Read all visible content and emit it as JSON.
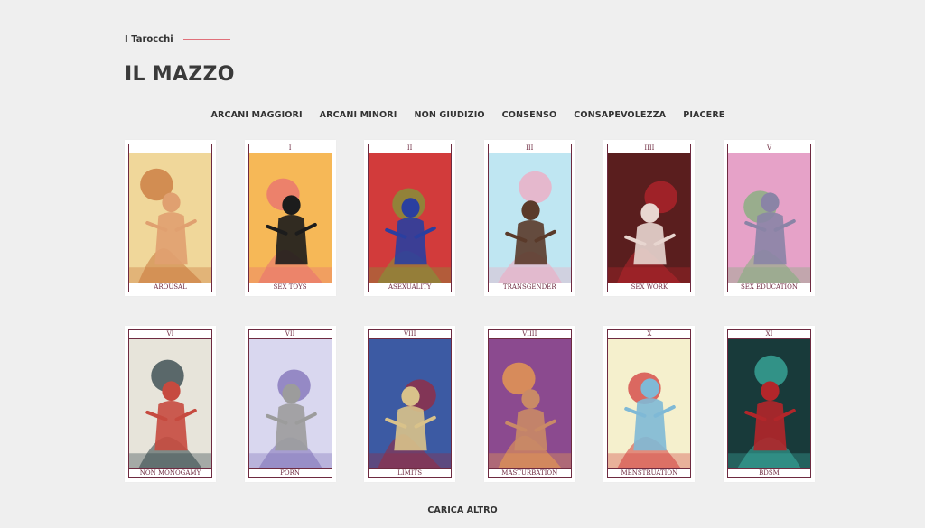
{
  "breadcrumb": {
    "label": "I Tarocchi"
  },
  "page_title": "IL MAZZO",
  "filters": [
    "ARCANI MAGGIORI",
    "ARCANI MINORI",
    "NON GIUDIZIO",
    "CONSENSO",
    "CONSAPEVOLEZZA",
    "PIACERE"
  ],
  "cards": [
    {
      "number": "",
      "name": "AROUSAL",
      "bg": "#f0d79a",
      "accent": "#c8743a",
      "figure": "#e0a070"
    },
    {
      "number": "I",
      "name": "SEX TOYS",
      "bg": "#f6b857",
      "accent": "#e86f72",
      "figure": "#1c1c1c"
    },
    {
      "number": "II",
      "name": "ASEXUALITY",
      "bg": "#d23b3b",
      "accent": "#7c9b3a",
      "figure": "#2a3fa0"
    },
    {
      "number": "III",
      "name": "TRANSGENDER",
      "bg": "#bfe6f2",
      "accent": "#f2a8c0",
      "figure": "#5a3a2a"
    },
    {
      "number": "IIII",
      "name": "SEX WORK",
      "bg": "#5a1e1e",
      "accent": "#b7242c",
      "figure": "#e8d6d0"
    },
    {
      "number": "V",
      "name": "SEX EDUCATION",
      "bg": "#e6a2c8",
      "accent": "#7fb07a",
      "figure": "#8a84a6"
    },
    {
      "number": "VI",
      "name": "NON MONOGAMY",
      "bg": "#e7e4da",
      "accent": "#2b3f44",
      "figure": "#c64a3f"
    },
    {
      "number": "VII",
      "name": "PORN",
      "bg": "#d9d7ef",
      "accent": "#7e6fb7",
      "figure": "#9c9c9c"
    },
    {
      "number": "VIII",
      "name": "LIMITS",
      "bg": "#3c5aa3",
      "accent": "#9a2a3c",
      "figure": "#d9c28a"
    },
    {
      "number": "VIIII",
      "name": "MASTURBATION",
      "bg": "#8b4a8f",
      "accent": "#f0a24a",
      "figure": "#c98a66"
    },
    {
      "number": "X",
      "name": "MENSTRUATION",
      "bg": "#f5f0cd",
      "accent": "#d23b3b",
      "figure": "#7fb9d6"
    },
    {
      "number": "XI",
      "name": "BDSM",
      "bg": "#183a3a",
      "accent": "#3bb0a2",
      "figure": "#b2262a"
    }
  ],
  "load_more_label": "CARICA ALTRO"
}
